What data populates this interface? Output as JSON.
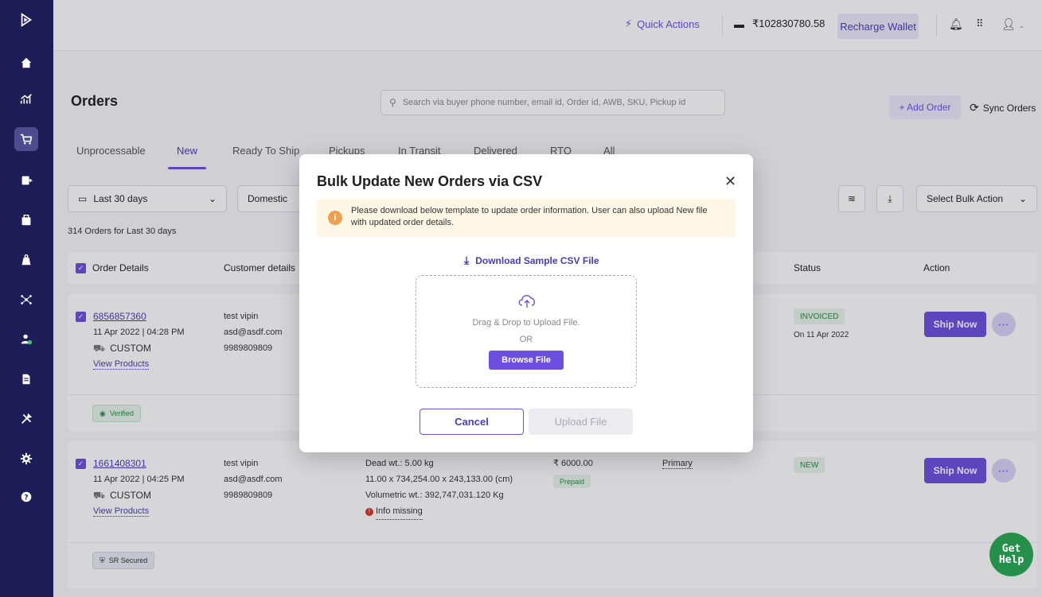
{
  "topbar": {
    "quick_actions": "Quick Actions",
    "wallet_amount": "₹102830780.58",
    "recharge_label": "Recharge Wallet"
  },
  "page": {
    "title": "Orders",
    "search_placeholder": "Search via buyer phone number, email id, Order id, AWB, SKU, Pickup id",
    "add_order": "+ Add Order",
    "sync_orders": "Sync Orders"
  },
  "tabs": [
    {
      "label": "Unprocessable"
    },
    {
      "label": "New"
    },
    {
      "label": "Ready To Ship"
    },
    {
      "label": "Pickups"
    },
    {
      "label": "In Transit"
    },
    {
      "label": "Delivered"
    },
    {
      "label": "RTO"
    },
    {
      "label": "All"
    }
  ],
  "filters": {
    "date_range": "Last 30 days",
    "domestic": "Domestic",
    "bulk_action": "Select Bulk Action"
  },
  "order_count_text": "314 Orders for Last 30 days",
  "table": {
    "headers": {
      "order_details": "Order Details",
      "customer_details": "Customer details",
      "status": "Status",
      "action": "Action"
    },
    "rows": [
      {
        "order_id": "6856857360",
        "date": "11 Apr 2022 | 04:28 PM",
        "channel": "CUSTOM",
        "view_products": "View Products",
        "customer_name": "test vipin",
        "customer_email": "asd@asdf.com",
        "customer_phone": "9989809809",
        "status": "INVOICED",
        "status_date": "On 11 Apr 2022",
        "action": "Ship Now",
        "footer_badge": "Verified"
      },
      {
        "order_id": "1661408301",
        "date": "11 Apr 2022 | 04:25 PM",
        "channel": "CUSTOM",
        "view_products": "View Products",
        "customer_name": "test vipin",
        "customer_email": "asd@asdf.com",
        "customer_phone": "9989809809",
        "dead_wt": "Dead wt.: 5.00 kg",
        "dimensions": "11.00 x 734,254.00 x 243,133.00 (cm)",
        "volumetric_wt": "Volumetric wt.: 392,747,031.120 Kg",
        "info_missing": "Info missing",
        "amount": "₹ 6000.00",
        "payment": "Prepaid",
        "pickup": "Primary",
        "status": "NEW",
        "action": "Ship Now",
        "footer_badge": "SR Secured"
      }
    ]
  },
  "modal": {
    "title": "Bulk Update New Orders via CSV",
    "info_text": "Please download below template to update order information. User can also upload New file with updated order details.",
    "download_link": "Download Sample CSV File",
    "drag_drop": "Drag & Drop to Upload File.",
    "or": "OR",
    "browse": "Browse File",
    "cancel": "Cancel",
    "upload": "Upload File"
  },
  "get_help": "Get Help",
  "colors": {
    "sidebar": "#1e1d58",
    "accent": "#6c4fe0",
    "accent_dark": "#4a3bb8",
    "info_bg": "#fff7e6",
    "help_green": "#25904a"
  }
}
